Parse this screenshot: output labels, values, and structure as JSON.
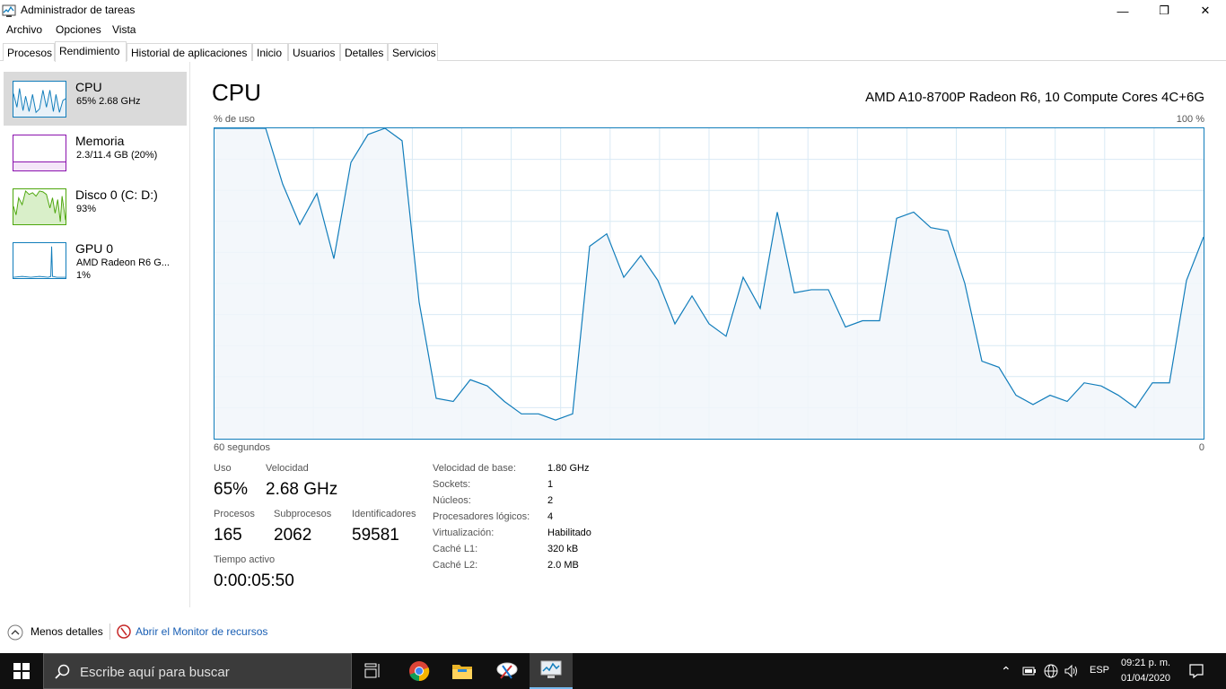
{
  "window": {
    "title": "Administrador de tareas",
    "minimize_glyph": "—",
    "maximize_glyph": "❐",
    "close_glyph": "✕"
  },
  "menu": [
    "Archivo",
    "Opciones",
    "Vista"
  ],
  "tabs": [
    "Procesos",
    "Rendimiento",
    "Historial de aplicaciones",
    "Inicio",
    "Usuarios",
    "Detalles",
    "Servicios"
  ],
  "active_tab": "Rendimiento",
  "sidebar": [
    {
      "name": "CPU",
      "sub": "65%  2.68 GHz",
      "sub2": "",
      "color": "#117dbb",
      "active": true
    },
    {
      "name": "Memoria",
      "sub": "2.3/11.4 GB (20%)",
      "sub2": "",
      "color": "#8b12ae",
      "active": false
    },
    {
      "name": "Disco 0 (C: D:)",
      "sub": "93%",
      "sub2": "",
      "color": "#4da60c",
      "active": false
    },
    {
      "name": "GPU 0",
      "sub": "AMD Radeon R6 G...",
      "sub2": "1%",
      "color": "#117dbb",
      "active": false
    }
  ],
  "main": {
    "title": "CPU",
    "model": "AMD A10-8700P Radeon R6, 10 Compute Cores 4C+6G",
    "graph_top_left": "% de uso",
    "graph_top_right": "100 %",
    "graph_bottom_left": "60 segundos",
    "graph_bottom_right": "0"
  },
  "chart_data": {
    "type": "area",
    "x_range": [
      60,
      0
    ],
    "ylim": [
      0,
      100
    ],
    "grid": true,
    "values": [
      100,
      100,
      100,
      100,
      82,
      69,
      79,
      58,
      89,
      98,
      100,
      96,
      44,
      13,
      12,
      19,
      17,
      12,
      8,
      8,
      6,
      8,
      62,
      66,
      52,
      59,
      51,
      37,
      46,
      37,
      33,
      52,
      42,
      73,
      47,
      48,
      48,
      36,
      38,
      38,
      71,
      73,
      68,
      67,
      50,
      25,
      23,
      14,
      11,
      14,
      12,
      18,
      17,
      14,
      10,
      18,
      18,
      51,
      65
    ],
    "color": "#117dbb"
  },
  "stats": {
    "uso_label": "Uso",
    "uso_value": "65%",
    "velocidad_label": "Velocidad",
    "velocidad_value": "2.68 GHz",
    "procesos_label": "Procesos",
    "procesos_value": "165",
    "subprocesos_label": "Subprocesos",
    "subprocesos_value": "2062",
    "identificadores_label": "Identificadores",
    "identificadores_value": "59581",
    "tiempo_label": "Tiempo activo",
    "tiempo_value": "0:00:05:50"
  },
  "info": [
    {
      "label": "Velocidad de base:",
      "value": "1.80 GHz"
    },
    {
      "label": "Sockets:",
      "value": "1"
    },
    {
      "label": "Núcleos:",
      "value": "2"
    },
    {
      "label": "Procesadores lógicos:",
      "value": "4"
    },
    {
      "label": "Virtualización:",
      "value": "Habilitado"
    },
    {
      "label": "Caché L1:",
      "value": "320 kB"
    },
    {
      "label": "Caché L2:",
      "value": "2.0 MB"
    }
  ],
  "footer": {
    "less_details": "Menos detalles",
    "resource_monitor": "Abrir el Monitor de recursos"
  },
  "taskbar": {
    "search_placeholder": "Escribe aquí para buscar",
    "language": "ESP",
    "time": "09:21 p. m.",
    "date": "01/04/2020"
  }
}
